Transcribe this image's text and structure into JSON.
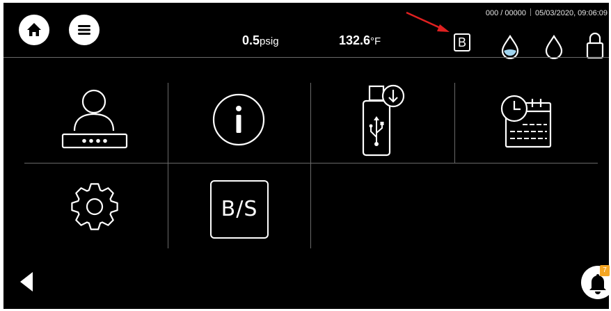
{
  "header": {
    "home_icon": "home-icon",
    "menu_icon": "menu-icon",
    "pressure": {
      "value": "0.5",
      "unit": "psig"
    },
    "temperature": {
      "value": "132.6",
      "unit": "°F"
    },
    "cycle_counter": "000 / 00000",
    "datetime": "05/03/2020, 09:06:09",
    "mode_badge": "B",
    "status_icons": [
      "water-drop-filled-icon",
      "water-drop-outline-icon",
      "lock-icon"
    ]
  },
  "menu": {
    "tiles": [
      {
        "name": "user-login",
        "icon": "user-password-icon"
      },
      {
        "name": "info",
        "icon": "info-icon"
      },
      {
        "name": "usb-download",
        "icon": "usb-download-icon"
      },
      {
        "name": "schedule",
        "icon": "calendar-clock-icon"
      },
      {
        "name": "settings",
        "icon": "gear-icon"
      },
      {
        "name": "bs-mode",
        "label": "B/S"
      }
    ]
  },
  "footer": {
    "back_icon": "back-arrow-icon",
    "bell_icon": "bell-icon",
    "notification_count": "7"
  },
  "annotation_color": "#e02020"
}
